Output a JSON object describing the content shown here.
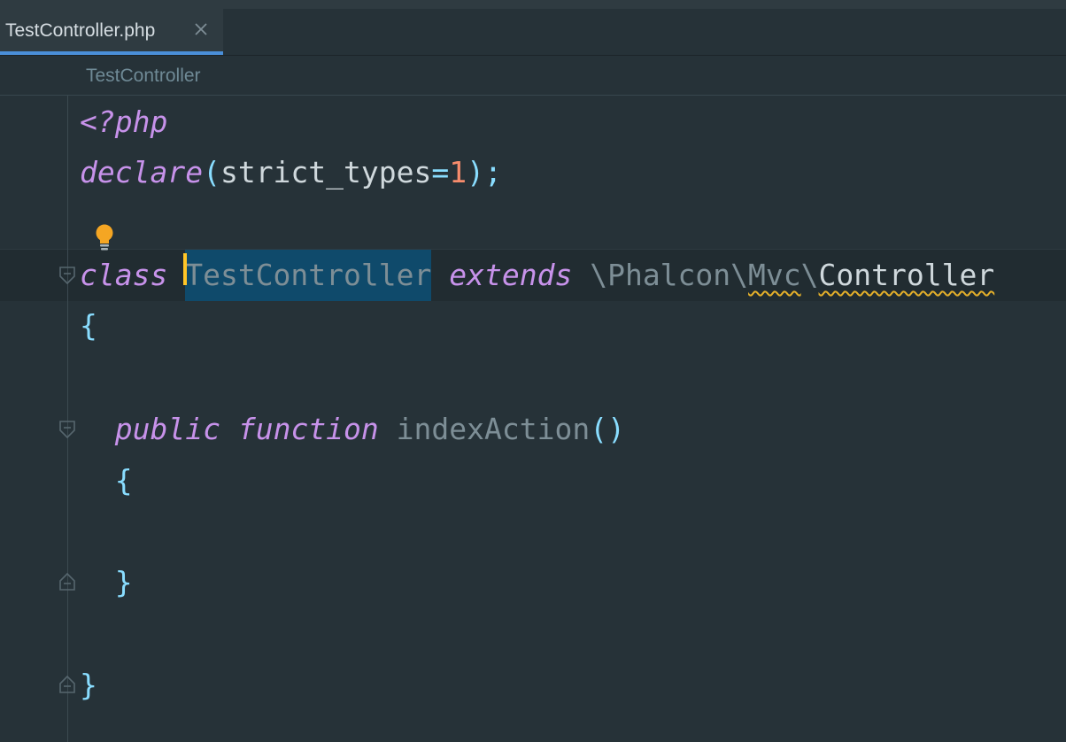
{
  "tab": {
    "filename": "TestController.php",
    "close_icon": "close-icon"
  },
  "breadcrumb": {
    "item": "TestController"
  },
  "code": {
    "line1": {
      "open_tag": "<?php"
    },
    "line2": {
      "keyword": "declare",
      "open_paren": "(",
      "name": "strict_types",
      "equals": "=",
      "value": "1",
      "close": ");"
    },
    "line3": {
      "keyword_class": "class",
      "class_name": "TestController",
      "keyword_extends": "extends",
      "ns_sep1": "\\",
      "ns1": "Phalcon",
      "ns_sep2": "\\",
      "ns2": "Mvc",
      "ns_sep3": "\\",
      "parent": "Controller"
    },
    "line4": {
      "brace": "{"
    },
    "line5": {
      "keyword_public": "public",
      "keyword_function": "function",
      "method": "indexAction",
      "parens": "()"
    },
    "line6": {
      "brace": "{"
    },
    "line7": {
      "brace": "}"
    },
    "line8": {
      "brace": "}"
    }
  },
  "colors": {
    "background": "#263238",
    "keyword": "#c792ea",
    "punctuation": "#89ddff",
    "number": "#f78c6c",
    "selection": "#0f4a6b",
    "caret": "#ffc627",
    "tab_underline": "#4a8fd9"
  },
  "icons": {
    "intention": "lightbulb-icon",
    "fold": "fold-marker-icon"
  }
}
